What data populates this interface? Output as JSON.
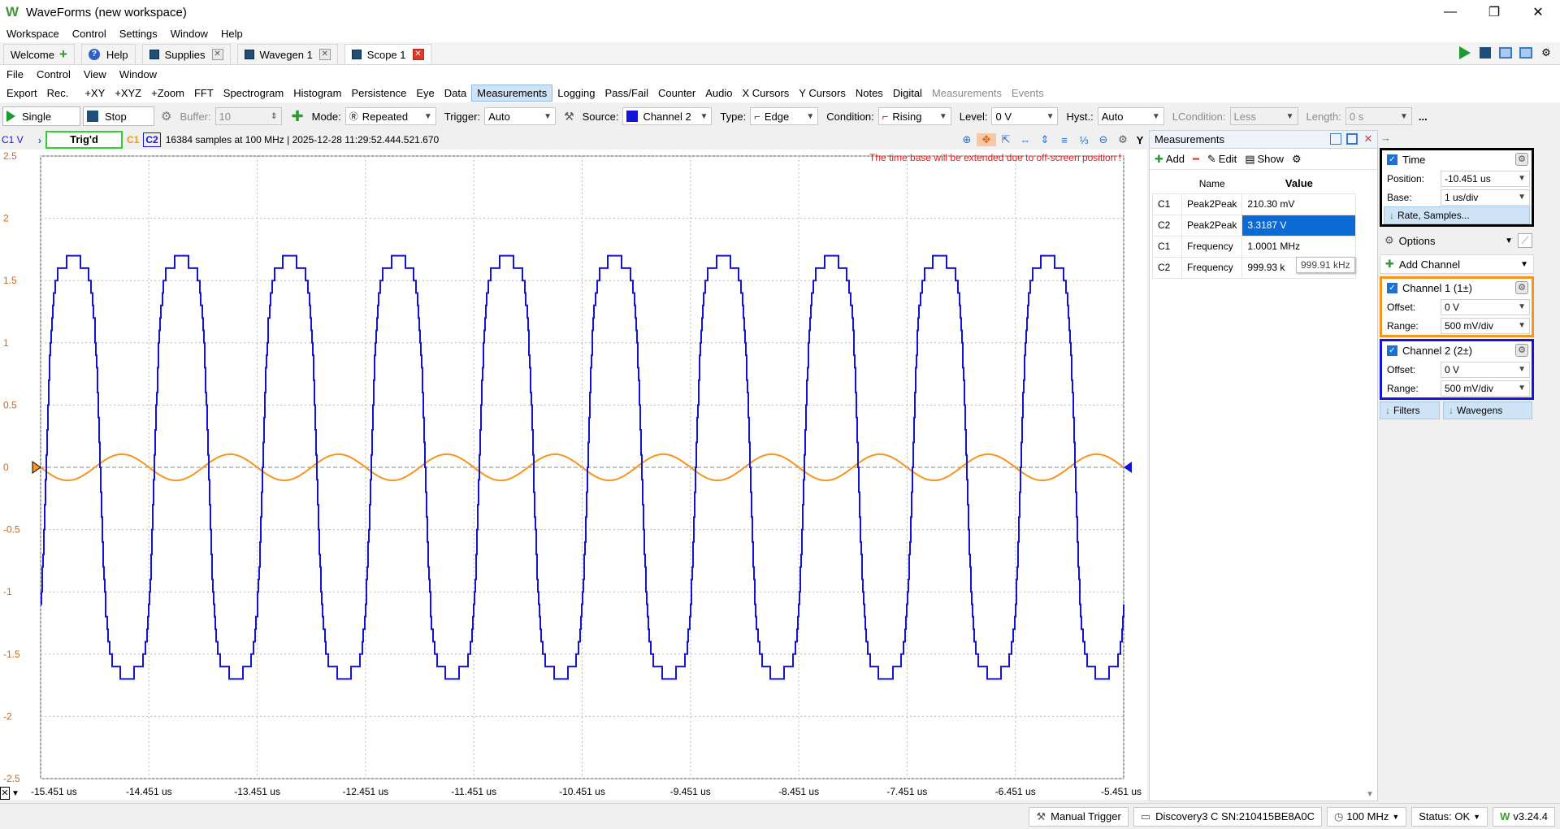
{
  "window": {
    "title": "WaveForms (new workspace)",
    "logo": "W",
    "controls": [
      "—",
      "❐",
      "✕"
    ]
  },
  "main_menu": [
    "Workspace",
    "Control",
    "Settings",
    "Window",
    "Help"
  ],
  "tabs": [
    {
      "label": "Welcome",
      "icon": "plus-icon"
    },
    {
      "label": "Help",
      "icon": "help-icon"
    },
    {
      "label": "Supplies",
      "icon": "instrument-icon",
      "close": "✕"
    },
    {
      "label": "Wavegen 1",
      "icon": "instrument-icon",
      "close": "✕"
    },
    {
      "label": "Scope 1",
      "icon": "instrument-icon",
      "close": "✕",
      "active": true
    }
  ],
  "scope_menu": [
    "File",
    "Control",
    "View",
    "Window"
  ],
  "toolbar": {
    "items": [
      "Export",
      "Rec.",
      "+XY",
      "+XYZ",
      "+Zoom",
      "FFT",
      "Spectrogram",
      "Histogram",
      "Persistence",
      "Eye",
      "Data",
      "Measurements",
      "Logging",
      "Pass/Fail",
      "Counter",
      "Audio",
      "X Cursors",
      "Y Cursors",
      "Notes",
      "Digital"
    ],
    "disabled_items": [
      "Measurements",
      "Events"
    ],
    "highlighted": "Measurements"
  },
  "acq": {
    "single_label": "Single",
    "stop_label": "Stop",
    "buffer_label": "Buffer:",
    "buffer_value": "10",
    "mode_label": "Mode:",
    "mode_value": "Repeated",
    "trigger_label": "Trigger:",
    "trigger_value": "Auto",
    "source_label": "Source:",
    "source_value": "Channel 2",
    "type_label": "Type:",
    "type_value": "Edge",
    "condition_label": "Condition:",
    "condition_value": "Rising",
    "level_label": "Level:",
    "level_value": "0 V",
    "hyst_label": "Hyst.:",
    "hyst_value": "Auto",
    "lcondition_label": "LCondition:",
    "lcondition_value": "Less",
    "length_label": "Length:",
    "length_value": "0 s",
    "more": "..."
  },
  "status": {
    "axis_unit": "C1 V",
    "trig_state": "Trig'd",
    "ch1": "C1",
    "ch2": "C2",
    "info": "16384 samples at 100 MHz  | 2025-12-28 11:29:52.444.521.670",
    "warning": "The time base will be extended due to off-screen position !"
  },
  "chart_data": {
    "type": "line",
    "ylim": [
      -2.5,
      2.5
    ],
    "y_ticks": [
      "2.5",
      "2",
      "1.5",
      "1",
      "0.5",
      "0",
      "-0.5",
      "-1",
      "-1.5",
      "-2",
      "-2.5"
    ],
    "x_ticks": [
      "-15.451 us",
      "-14.451 us",
      "-13.451 us",
      "-12.451 us",
      "-11.451 us",
      "-10.451 us",
      "-9.451 us",
      "-8.451 us",
      "-7.451 us",
      "-6.451 us",
      "-5.451 us"
    ],
    "xlim_us": [
      -15.451,
      -5.451
    ],
    "series": [
      {
        "name": "C1",
        "color": "#f7941d",
        "shape": "sine",
        "frequency_mhz": 1.0001,
        "peak2peak_v": 0.2103,
        "offset_v": 0
      },
      {
        "name": "C2",
        "color": "#1414d8",
        "shape": "square-rounded",
        "frequency_khz": 999.93,
        "peak2peak_v": 3.3187,
        "offset_v": 0
      }
    ]
  },
  "measurements": {
    "title": "Measurements",
    "add_label": "Add",
    "edit_label": "Edit",
    "show_label": "Show",
    "col_name": "Name",
    "col_value": "Value",
    "rows": [
      {
        "ch": "C1",
        "name": "Peak2Peak",
        "value": "210.30 mV"
      },
      {
        "ch": "C2",
        "name": "Peak2Peak",
        "value": "3.3187 V"
      },
      {
        "ch": "C1",
        "name": "Frequency",
        "value": "1.0001 MHz"
      },
      {
        "ch": "C2",
        "name": "Frequency",
        "value": "999.93 k"
      }
    ],
    "tooltip": "999.91 kHz"
  },
  "settings": {
    "time": {
      "title": "Time",
      "position_label": "Position:",
      "position_value": "-10.451 us",
      "base_label": "Base:",
      "base_value": "1 us/div",
      "rate_label": "Rate, Samples..."
    },
    "options_label": "Options",
    "add_channel_label": "Add Channel",
    "channel1": {
      "title": "Channel 1 (1±)",
      "color": "#f7941d",
      "offset_label": "Offset:",
      "offset_value": "0 V",
      "range_label": "Range:",
      "range_value": "500 mV/div"
    },
    "channel2": {
      "title": "Channel 2 (2±)",
      "color": "#1414d8",
      "offset_label": "Offset:",
      "offset_value": "0 V",
      "range_label": "Range:",
      "range_value": "500 mV/div"
    },
    "filters_label": "Filters",
    "wavegens_label": "Wavegens"
  },
  "bottom": {
    "manual_trigger": "Manual Trigger",
    "device": "Discovery3 C SN:210415BE8A0C",
    "rate": "100 MHz",
    "status": "Status: OK",
    "version": "v3.24.4"
  },
  "colors": {
    "accent": "#0a6bd6",
    "ch1": "#f7941d",
    "ch2": "#1414d8",
    "trig": "#2fd12f",
    "warning": "#e02020"
  }
}
